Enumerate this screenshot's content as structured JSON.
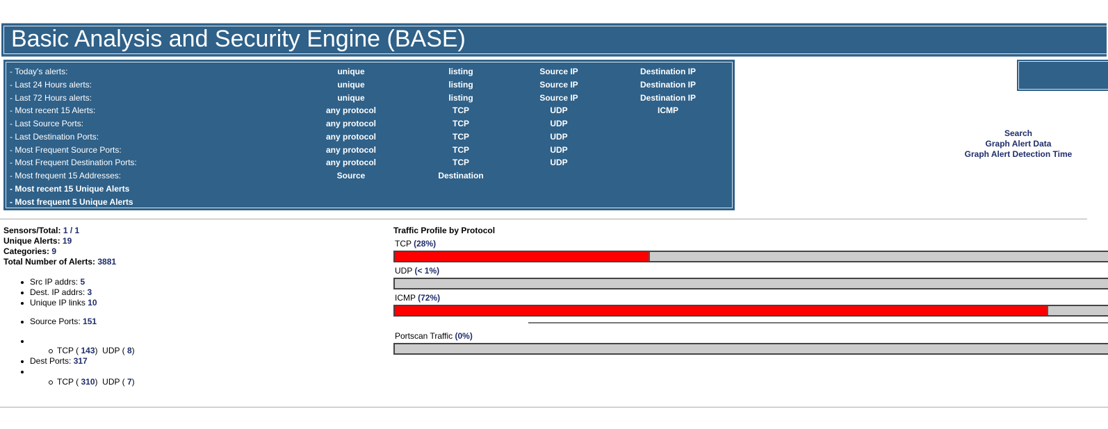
{
  "header": {
    "title": "Basic Analysis and Security Engine (BASE)"
  },
  "panel": {
    "rows": [
      {
        "label": "- Today's alerts:",
        "cols": [
          "unique",
          "listing",
          "Source IP",
          "Destination IP"
        ]
      },
      {
        "label": "- Last 24 Hours alerts:",
        "cols": [
          "unique",
          "listing",
          "Source IP",
          "Destination IP"
        ]
      },
      {
        "label": "- Last 72 Hours alerts:",
        "cols": [
          "unique",
          "listing",
          "Source IP",
          "Destination IP"
        ]
      },
      {
        "label": "- Most recent 15 Alerts:",
        "cols": [
          "any protocol",
          "TCP",
          "UDP",
          "ICMP"
        ]
      },
      {
        "label": "- Last Source Ports:",
        "cols": [
          "any protocol",
          "TCP",
          "UDP"
        ]
      },
      {
        "label": "- Last Destination Ports:",
        "cols": [
          "any protocol",
          "TCP",
          "UDP"
        ]
      },
      {
        "label": "- Most Frequent Source Ports:",
        "cols": [
          "any protocol",
          "TCP",
          "UDP"
        ]
      },
      {
        "label": "- Most Frequent Destination Ports:",
        "cols": [
          "any protocol",
          "TCP",
          "UDP"
        ]
      },
      {
        "label": "- Most frequent 15 Addresses:",
        "cols": [
          "Source",
          "Destination"
        ]
      },
      {
        "label": "- Most recent 15 Unique Alerts",
        "cols": []
      },
      {
        "label": "- Most frequent 5 Unique Alerts",
        "cols": []
      }
    ]
  },
  "right_links": [
    "Search",
    "Graph Alert Data",
    "Graph Alert Detection Time"
  ],
  "stats": {
    "sensors_label": "Sensors/Total:",
    "sensors_value": "1",
    "sensors_sep": " / ",
    "sensors_total": "1",
    "unique_label": "Unique Alerts:",
    "unique_value": "19",
    "categories_label": "Categories:",
    "categories_value": "9",
    "total_label": "Total Number of Alerts:",
    "total_value": "3881",
    "src_ip_label": "Src IP addrs:",
    "src_ip_value": "5",
    "dst_ip_label": "Dest. IP addrs:",
    "dst_ip_value": "3",
    "ip_links_label": "Unique IP links",
    "ip_links_value": "10",
    "src_ports_label": "Source Ports:",
    "src_ports_value": "151",
    "src_tcp_label": "TCP (",
    "src_tcp_value": "143",
    "src_udp_label": ")  UDP (",
    "src_udp_value": "8",
    "close": ")",
    "dst_ports_label": "Dest Ports:",
    "dst_ports_value": "317",
    "dst_tcp_label": "TCP (",
    "dst_tcp_value": "310",
    "dst_udp_label": ")  UDP (",
    "dst_udp_value": "7"
  },
  "traffic": {
    "title": "Traffic Profile by Protocol",
    "tcp_label": "TCP",
    "tcp_pct": "(28%)",
    "tcp_fill": 0.355,
    "udp_label": "UDP",
    "udp_pct": "(< 1%)",
    "udp_fill": 0,
    "icmp_label": "ICMP",
    "icmp_pct": "(72%)",
    "icmp_fill": 0.912,
    "portscan_label": "Portscan Traffic",
    "portscan_pct": "(0%)",
    "portscan_fill": 0
  },
  "colors": {
    "accent": "#2f6189",
    "link": "#1f2d6b",
    "bar_fill": "#ff0000",
    "bar_bg": "#cccccc"
  }
}
